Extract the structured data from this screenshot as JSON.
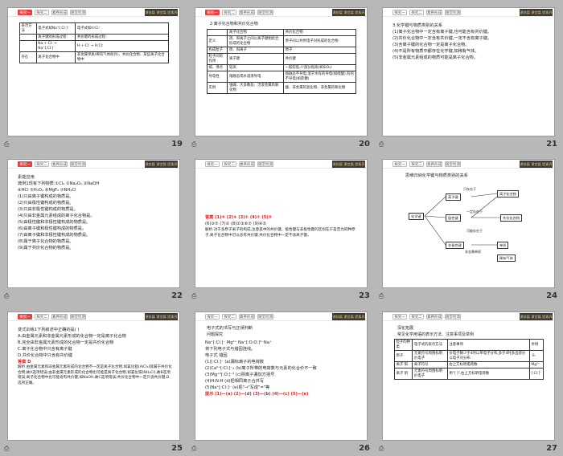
{
  "common": {
    "tab1": "探究一",
    "tab2": "探究二",
    "tab3": "素养形成",
    "tab4": "随堂检测",
    "brand": "课前篇 课堂篇 提素养",
    "doc_icon": "⎙"
  },
  "slides": [
    {
      "number": "19",
      "table": [
        [
          "表示方法",
          "电子式如Na⁺[:Cl:]⁻",
          "电子式如H:Cl:"
        ],
        [
          "",
          "离子键的形成过程：",
          "共价键的形成过程："
        ],
        [
          "",
          "Na·+·Cl: → Na⁺[:Cl:]⁻",
          "H·+·Cl: → H:Cl:"
        ],
        [
          "存在",
          "离子化合物中",
          "非金属单质(稀有气体除外)、共价化合物、某些离子化合物中"
        ]
      ]
    },
    {
      "number": "20",
      "heading": "2.离子化合物和共价化合物",
      "table": [
        [
          "",
          "离子化合物",
          "共价化合物"
        ],
        [
          "定义",
          "阴、阳离子之间以离子键相结合形成的化合物",
          "原子间以共用电子对形成的化合物"
        ],
        [
          "构成粒子",
          "阴、阳离子",
          "原子"
        ],
        [
          "粒子间的作用",
          "离子键",
          "共价键"
        ],
        [
          "熔、沸点",
          "较高",
          "一般较低,少部分很高(如SiO₂)"
        ],
        [
          "导电性",
          "熔融态或水溶液导电",
          "熔融态不导电,溶于水有的导电(如硫酸),有的不导电(如蔗糖)"
        ],
        [
          "实例",
          "强碱、大多数盐、活泼金属的氧化物",
          "酸、非金属的氢化物、非金属的氧化物"
        ]
      ]
    },
    {
      "number": "21",
      "lines": [
        "3.化学键与物质类别的关系",
        "(1)离子化合物中一定含有离子键,也可能含有共价键。",
        "(2)共价化合物中一定含有共价键,一定不含有离子键。",
        "(3)含离子键的化合物一定是离子化合物。",
        "(4)不是所有物质中都存在化学键,如稀有气体。",
        "(5)非金属元素组成的物质可能是离子化合物。"
      ]
    },
    {
      "number": "22",
      "lines": [
        "素能应用",
        "典例1现有下列物质:①Cl₂ ②Na₂O₂ ③NaOH",
        "④HCl ⑤H₂O₂ ⑥MgF₂ ⑦NH₄Cl",
        "(1)只由离子键构成的物质是。",
        "(2)只由极性键构成的物质是。",
        "(3)只由非极性键构成的物质是。",
        "(4)只由非金属元素组成的离子化合物是。",
        "(5)由极性键和非极性键构成的物质是。",
        "(6)由离子键和极性键构成的物质是。",
        "(7)由离子键和非极性键构成的物质是。",
        "(8)属于离子化合物的物质是。",
        "(9)属于共价化合物的物质是。"
      ]
    },
    {
      "number": "23",
      "answer": "答案 (1)⑥ (2)④ (3)① (4)⑦ (5)⑤",
      "answer2": "(6)③⑦ (7)② (8)②③⑥⑦ (9)④⑤",
      "analysis": "解析 对于多原子离子的构成,注意其中的共价键。极性键与非极性键的区别在于是否为同种原子,离子化合物中可以含有共价键,共价化合物中一定不含离子键。"
    },
    {
      "number": "24",
      "heading": "思维归纳化学键与物质类别的关系",
      "nodes": {
        "root": "化学键",
        "ionic": "离子键",
        "polar": "极性键",
        "nonpolar": "非极性键",
        "ionic_cmp": "离子化合物",
        "covalent_cmp": "共价化合物",
        "simple": "单质",
        "no_bond": "稀有气体",
        "cond1": "只存在于",
        "cond2": "一定存在于",
        "cond3": "可能存在于",
        "cond4": "非金属单质"
      }
    },
    {
      "number": "25",
      "lines": [
        "变式训练1下列叙述中正确的是( )",
        "A.由金属元素和非金属元素形成的化合物一定是离子化合物",
        "B.完全由非金属元素形成的化合物一定是共价化合物",
        "C.离子化合物中只含有离子键",
        "D.共价化合物中只含有共价键"
      ],
      "answer": "答案 D",
      "analysis": "解析 由金属元素和非金属元素形成的化合物不一定是离子化合物,如氯化铝(AlCl₃)就属于共价化合物,故A选项错误;由非金属元素形成的化合物也可能是离子化合物,如氯化铵(NH₄Cl),故B选项错误;离子化合物中也可能含有共价键,如NaOH,故C选项错误;共价化合物中一定只含共价键,D选项正确。"
    },
    {
      "number": "26",
      "heading": "电子式的书写与正误判断",
      "sub": "问题探究",
      "lines": [
        "Na⁺[:Cl:]⁻ Mg²⁺ Na⁺[:O:O:]²⁻Na⁺",
        "将下列电子式与错因连线。",
        "电子式 错因",
        "(1)[:Cl:]⁻ (a)漏标离子的电荷数",
        "(2)Ca²⁺[:Cl:]⁻₂ (b)离子所带的电荷数与元素的化合价不一致",
        "(3)Mg⁺²[:O:]⁻² (c)阴离子漏加方括号",
        "(4)H:N:H (d)把相同离子合并写",
        "(5)Na⁺[:Cl:]⁻ (e)把\"→\"写成\"=\"等"
      ],
      "hint": "提示 (1)—(a) (2)—(d) (3)—(b) (4)—(c) (5)—(e)"
    },
    {
      "number": "27",
      "heading": "深化拓展",
      "sub": "常见化学用语的表示方法、注意事项及举例",
      "table": [
        [
          "粒子的种类",
          "电子式的表示方法",
          "注意事项",
          "举例"
        ],
        [
          "原子",
          "元素符号周围标明价电子",
          "价电子数少于4时以单电子分布,多于4时多出部分以电子对分布",
          "·S·"
        ],
        [
          "离子 阳",
          "离子符号",
          "右上方标明电荷数",
          "Mg²⁺"
        ],
        [
          "离子 阴",
          "元素符号周围标明价电子",
          "用\"[ ]\",右上方标明电荷数",
          "[:Cl:]⁻"
        ]
      ]
    }
  ]
}
